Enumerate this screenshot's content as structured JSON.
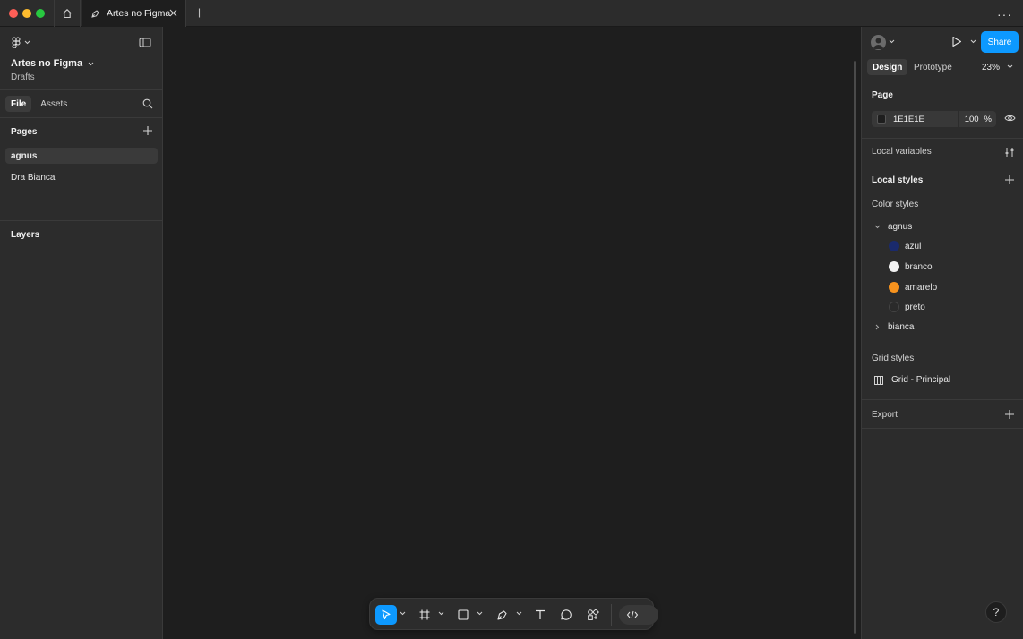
{
  "window": {
    "tab_title": "Artes no Figma",
    "more_menu": "···"
  },
  "left_panel": {
    "file_name": "Artes no Figma",
    "location": "Drafts",
    "tabs": [
      {
        "label": "File",
        "active": true
      },
      {
        "label": "Assets",
        "active": false
      }
    ],
    "pages_title": "Pages",
    "pages": [
      {
        "label": "agnus",
        "active": true
      },
      {
        "label": "Dra Bianca",
        "active": false
      }
    ],
    "layers_title": "Layers"
  },
  "toolbar": {
    "tools": [
      {
        "name": "move-tool",
        "icon": "cursor-icon",
        "active": true,
        "has_menu": true
      },
      {
        "name": "frame-tool",
        "icon": "frame-hash-icon",
        "active": false,
        "has_menu": true
      },
      {
        "name": "shape-tool",
        "icon": "rectangle-icon",
        "active": false,
        "has_menu": true
      },
      {
        "name": "pen-tool",
        "icon": "pen-icon",
        "active": false,
        "has_menu": true
      },
      {
        "name": "text-tool",
        "icon": "text-icon",
        "active": false,
        "has_menu": false
      },
      {
        "name": "comment-tool",
        "icon": "comment-icon",
        "active": false,
        "has_menu": false
      },
      {
        "name": "resources-tool",
        "icon": "components-icon",
        "active": false,
        "has_menu": false
      }
    ],
    "dev_mode_icon": "code-icon",
    "accent_color": "#0d99ff"
  },
  "right_panel": {
    "share_label": "Share",
    "tabs": [
      {
        "label": "Design",
        "active": true
      },
      {
        "label": "Prototype",
        "active": false
      }
    ],
    "zoom": "23%",
    "page_section": {
      "title": "Page",
      "background_hex": "1E1E1E",
      "opacity": "100",
      "opacity_unit": "%"
    },
    "local_variables_label": "Local variables",
    "local_styles_title": "Local styles",
    "color_styles_label": "Color styles",
    "color_groups": [
      {
        "name": "agnus",
        "expanded": true,
        "colors": [
          {
            "name": "azul",
            "color": "#1a2a6c"
          },
          {
            "name": "branco",
            "color": "#f2f2f2"
          },
          {
            "name": "amarelo",
            "color": "#f7931e"
          },
          {
            "name": "preto",
            "color": "#2a2a2a"
          }
        ]
      },
      {
        "name": "bianca",
        "expanded": false
      }
    ],
    "grid_styles_label": "Grid styles",
    "grid_items": [
      {
        "name": "Grid - Principal"
      }
    ],
    "export_label": "Export",
    "help_label": "?"
  },
  "colors": {
    "canvas": "#1e1e1e",
    "panel": "#2c2c2c",
    "accent": "#0d99ff"
  }
}
